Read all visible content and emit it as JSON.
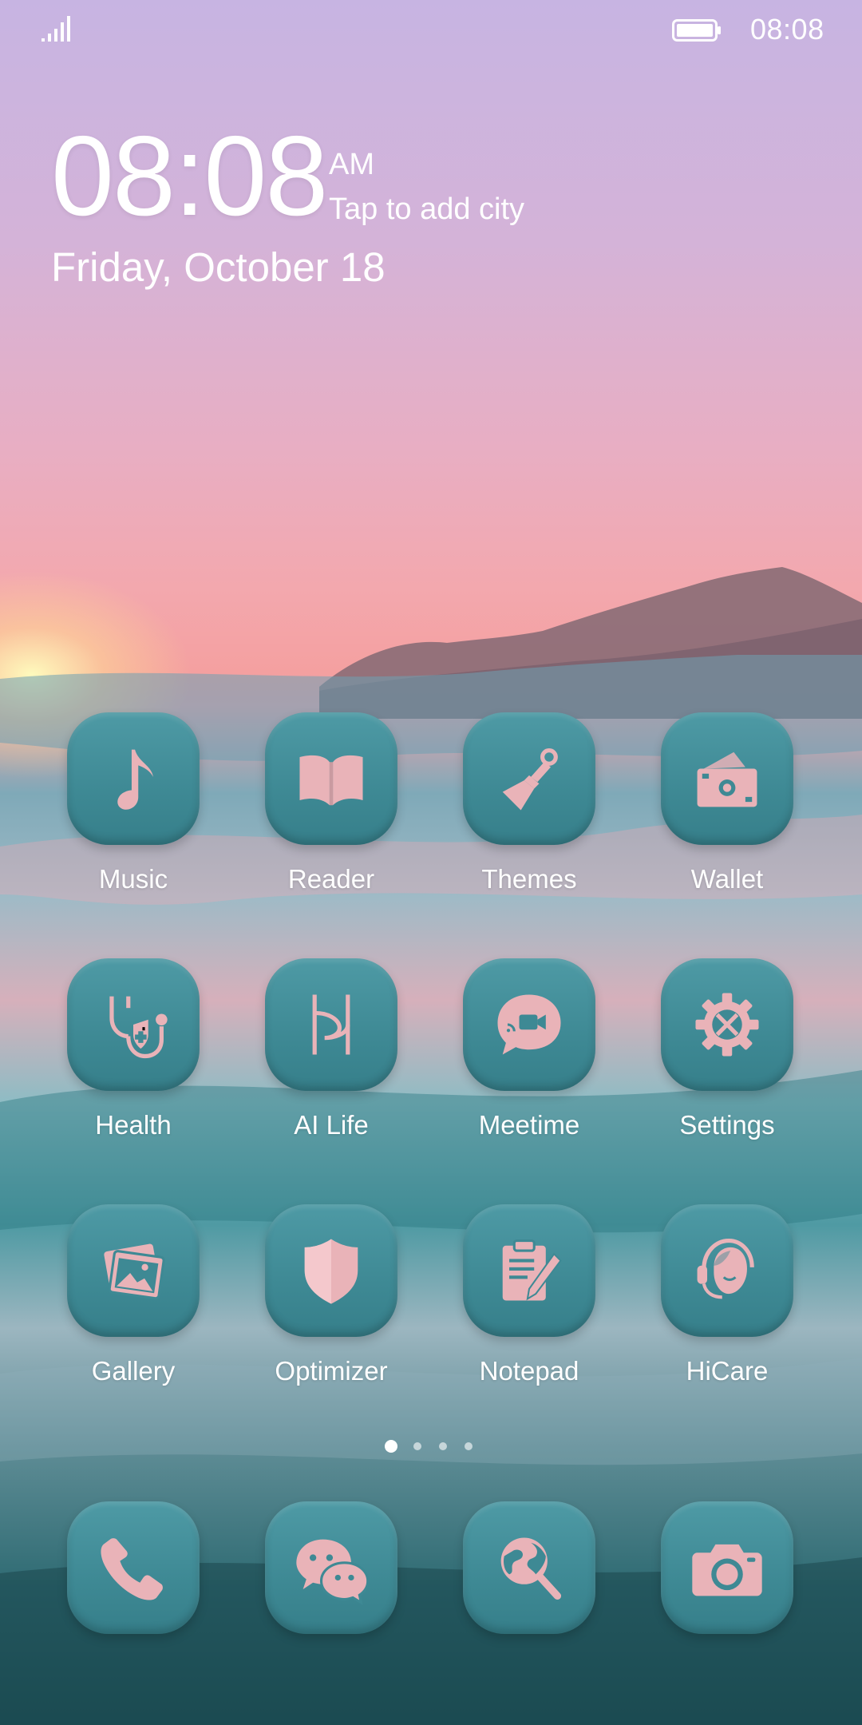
{
  "status_bar": {
    "time": "08:08",
    "signal_icon": "signal-icon",
    "battery_icon": "battery-icon"
  },
  "clock": {
    "time": "08:08",
    "ampm": "AM",
    "city": "Tap to add city",
    "date": "Friday, October 18"
  },
  "apps": [
    {
      "label": "Music",
      "icon": "music-note-icon"
    },
    {
      "label": "Reader",
      "icon": "book-icon"
    },
    {
      "label": "Themes",
      "icon": "paintbrush-icon"
    },
    {
      "label": "Wallet",
      "icon": "wallet-icon"
    },
    {
      "label": "Health",
      "icon": "stethoscope-icon"
    },
    {
      "label": "AI Life",
      "icon": "ai-life-icon"
    },
    {
      "label": "Meetime",
      "icon": "video-chat-icon"
    },
    {
      "label": "Settings",
      "icon": "gear-wrench-icon"
    },
    {
      "label": "Gallery",
      "icon": "photos-icon"
    },
    {
      "label": "Optimizer",
      "icon": "shield-icon"
    },
    {
      "label": "Notepad",
      "icon": "notepad-icon"
    },
    {
      "label": "HiCare",
      "icon": "headset-icon"
    }
  ],
  "dock": [
    {
      "icon": "phone-icon"
    },
    {
      "icon": "messaging-icon"
    },
    {
      "icon": "browser-icon"
    },
    {
      "icon": "camera-icon"
    }
  ],
  "page_indicator": {
    "pages": 4,
    "current": 1
  },
  "colors": {
    "icon_tile": "#3e8994",
    "glyph": "#e9b3b8"
  }
}
